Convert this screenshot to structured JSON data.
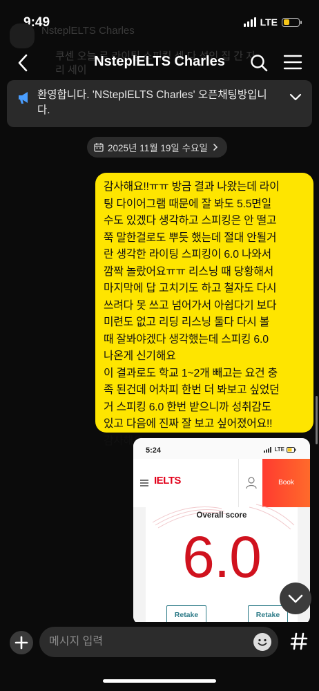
{
  "status_bar": {
    "time": "9:49",
    "network": "LTE",
    "battery_level": 0.4
  },
  "background_ghost": {
    "sender_name": "NsteplELTS Charles",
    "preview": "쿠센 오늘 로 라이팅 스피킹 셋 다 섞인 집 간 자리 세이"
  },
  "header": {
    "title": "NsteplELTS Charles",
    "back_icon": "chevron-left-icon",
    "search_icon": "search-icon",
    "menu_icon": "hamburger-menu-icon"
  },
  "notice": {
    "text": "환영합니다. 'NStepIELTS Charles' 오픈채팅방입니다.",
    "icon": "megaphone-icon"
  },
  "date_chip": {
    "label": "2025년 11월 19일 수요일"
  },
  "message": {
    "lines": [
      "감사해요!!ㅠㅠ 방금 결과 나왔는데 라이",
      "팅 다이어그램 때문에 잘 봐도 5.5면일",
      "수도 있겠다 생각하고 스피킹은 안 떨고",
      "쭉 말한걸로도 뿌듯 했는데 절대 안될거",
      "란 생각한 라이팅 스피킹이 6.0 나와서",
      "깜짝 놀랐어요ㅠㅠ 리스닝 때 당황해서",
      "마지막에 답 고치기도 하고 철자도 다시",
      "쓰려다 못 쓰고 넘어가서 아쉽다기 보다",
      "미련도 없고 리딩 리스닝 둘다 다시 볼",
      "때 잘봐야겠다 생각했는데 스피킹 6.0",
      "나온게 신기해요",
      "이 결과로도 학교 1~2개 빼고는 요건 충",
      "족 된건데 어차피 한번 더 봐보고 싶었던",
      "거 스피킹 6.0 한번 받으니까 성취감도",
      "있고 다음에 진짜 잘 보고 싶어졌어요!!",
      "감사해요ㅠㅠ"
    ]
  },
  "screenshot_preview": {
    "time": "5:24",
    "network": "LTE",
    "logo": "IELTS",
    "book_label": "Book",
    "overall_label": "Overall score",
    "score": "6.0",
    "retake_left": "Retake",
    "retake_right": "Retake"
  },
  "composer": {
    "placeholder": "메시지 입력",
    "plus_icon": "plus-icon",
    "emoji_icon": "emoji-icon",
    "hash_icon": "hash-icon"
  },
  "scroll_down_icon": "chevron-down-icon"
}
